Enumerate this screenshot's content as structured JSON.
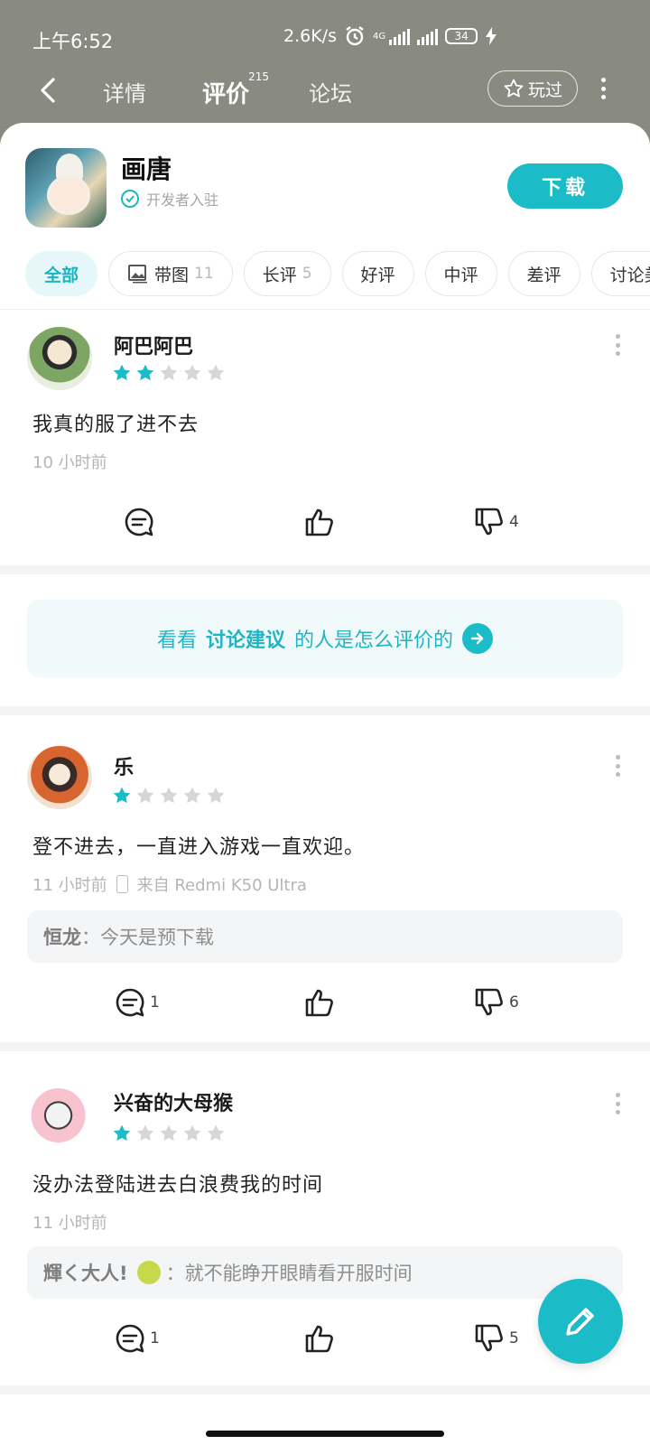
{
  "status": {
    "time": "上午6:52",
    "speed": "2.6K/s",
    "net": "4G",
    "battery": "34"
  },
  "nav": {
    "tabs": [
      {
        "label": "详情"
      },
      {
        "label": "评价",
        "badge": "215"
      },
      {
        "label": "论坛"
      }
    ],
    "played_label": "玩过"
  },
  "app": {
    "name": "画唐",
    "dev_tag": "开发者入驻",
    "download_label": "下载"
  },
  "filters": [
    {
      "label": "全部",
      "count": ""
    },
    {
      "label": "带图",
      "count": "11"
    },
    {
      "label": "长评",
      "count": "5"
    },
    {
      "label": "好评",
      "count": ""
    },
    {
      "label": "中评",
      "count": ""
    },
    {
      "label": "差评",
      "count": ""
    },
    {
      "label": "讨论美",
      "count": ""
    }
  ],
  "reviews": [
    {
      "user": "阿巴阿巴",
      "rating": 2,
      "text": "我真的服了进不去",
      "time": "10 小时前",
      "device": "",
      "reply_user": "",
      "reply_text": "",
      "comments": "",
      "likes": "",
      "dislikes": "4"
    },
    {
      "user": "乐",
      "rating": 1,
      "text": "登不进去，一直进入游戏一直欢迎。",
      "time": "11 小时前",
      "device": "来自 Redmi K50 Ultra",
      "reply_user": "恒龙",
      "reply_text": "：今天是预下载",
      "comments": "1",
      "likes": "",
      "dislikes": "6"
    },
    {
      "user": "兴奋的大母猴",
      "rating": 1,
      "text": "没办法登陆进去白浪费我的时间",
      "time": "11 小时前",
      "device": "",
      "reply_user": "輝く大人!",
      "reply_text": "：就不能睁开眼睛看开服时间",
      "comments": "1",
      "likes": "",
      "dislikes": "5"
    }
  ],
  "banner": {
    "pre": "看看",
    "highlight": "讨论建议",
    "post": "的人是怎么评价的"
  },
  "colors": {
    "accent": "#1bbcc8",
    "header_bg": "#8a8b80",
    "star_on": "#1bbcc8",
    "star_off": "#d6d6d6"
  }
}
